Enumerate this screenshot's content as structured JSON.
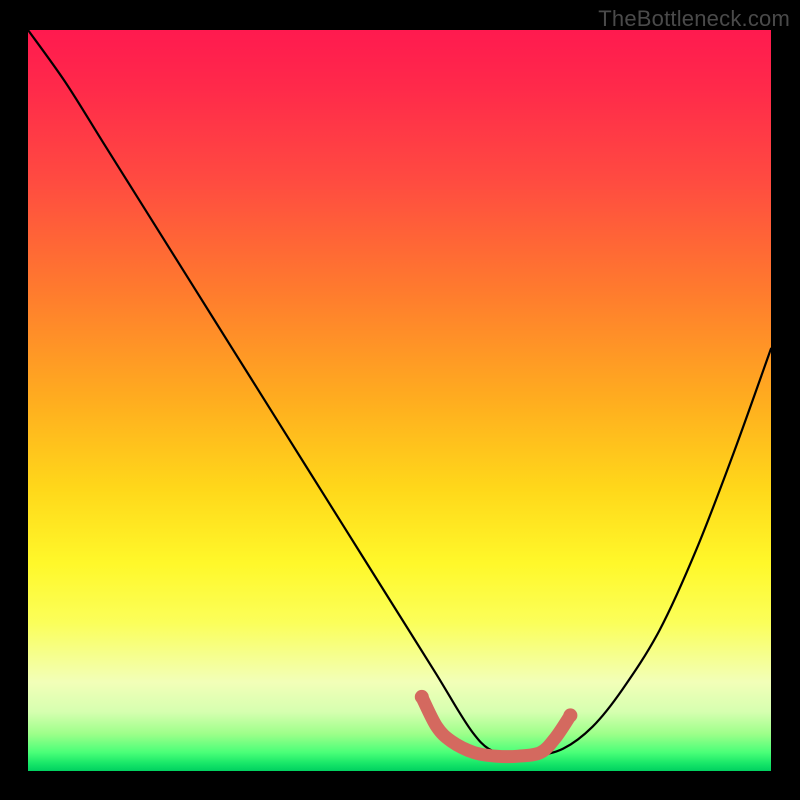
{
  "attribution": "TheBottleneck.com",
  "chart_data": {
    "type": "line",
    "title": "",
    "xlabel": "",
    "ylabel": "",
    "xlim": [
      0,
      100
    ],
    "ylim": [
      0,
      100
    ],
    "grid": false,
    "legend": false,
    "series": [
      {
        "name": "mismatch-curve-black",
        "color": "#000000",
        "x": [
          0,
          5,
          10,
          15,
          20,
          25,
          30,
          35,
          40,
          45,
          50,
          55,
          58,
          60,
          62,
          65,
          68,
          72,
          76,
          80,
          85,
          90,
          95,
          100
        ],
        "values": [
          100,
          93,
          85,
          77,
          69,
          61,
          53,
          45,
          37,
          29,
          21,
          13,
          8,
          5,
          3,
          2,
          2,
          3,
          6,
          11,
          19,
          30,
          43,
          57
        ]
      },
      {
        "name": "optimal-band-red",
        "color": "#d4695f",
        "x": [
          53,
          55,
          57,
          60,
          63,
          66,
          69,
          71,
          73
        ],
        "values": [
          10,
          6,
          4,
          2.5,
          2,
          2,
          2.5,
          4.5,
          7.5
        ]
      }
    ],
    "gradient_stops": [
      {
        "pos": 0.0,
        "color": "#ff1a4f"
      },
      {
        "pos": 0.5,
        "color": "#ffad1f"
      },
      {
        "pos": 0.72,
        "color": "#fff82a"
      },
      {
        "pos": 0.95,
        "color": "#9dff8a"
      },
      {
        "pos": 1.0,
        "color": "#00d060"
      }
    ]
  }
}
